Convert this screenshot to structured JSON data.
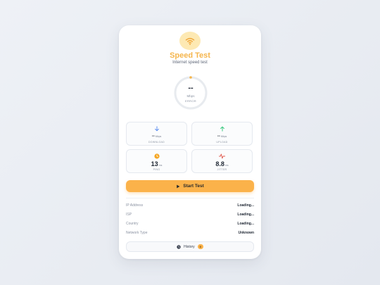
{
  "app": {
    "title": "Speed Test",
    "subtitle": "Internet speed test"
  },
  "gauge": {
    "value": "--",
    "unit": "Mbps",
    "status": "ERROR",
    "accent": "#f5b54c"
  },
  "stats": {
    "download": {
      "value": "--",
      "unit": "Mbps",
      "label": "DOWNLOAD",
      "color": "#5b8def"
    },
    "upload": {
      "value": "--",
      "unit": "Mbps",
      "label": "UPLOAD",
      "color": "#34c77b"
    },
    "ping": {
      "value": "13",
      "unit": "ms",
      "label": "PING",
      "color": "#f5a623"
    },
    "jitter": {
      "value": "8.8",
      "unit": "ms",
      "label": "JITTER",
      "color": "#e0564a"
    }
  },
  "start_button": {
    "label": "Start Test"
  },
  "info": [
    {
      "key": "IP Address",
      "value": "Loading..."
    },
    {
      "key": "ISP",
      "value": "Loading..."
    },
    {
      "key": "Country",
      "value": "Loading..."
    },
    {
      "key": "Network Type",
      "value": "Unknown"
    }
  ],
  "history": {
    "label": "History",
    "count": "0"
  }
}
